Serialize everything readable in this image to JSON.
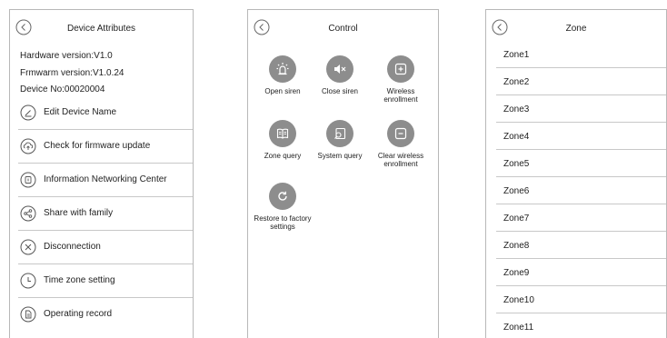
{
  "device_panel": {
    "title": "Device Attributes",
    "hardware_version": "Hardware version:V1.0",
    "firmware_version": "Frmwarm version:V1.0.24",
    "device_no": "Device No:00020004",
    "items": [
      {
        "label": "Edit Device Name",
        "icon": "edit-icon"
      },
      {
        "label": "Check for firmware update",
        "icon": "cloud-upload-icon"
      },
      {
        "label": "Information Networking Center",
        "icon": "info-center-icon"
      },
      {
        "label": "Share with family",
        "icon": "share-icon"
      },
      {
        "label": "Disconnection",
        "icon": "close-circle-icon"
      },
      {
        "label": "Time zone setting",
        "icon": "clock-icon"
      },
      {
        "label": "Operating record",
        "icon": "document-icon"
      }
    ]
  },
  "control_panel": {
    "title": "Control",
    "buttons": [
      {
        "label": "Open siren",
        "icon": "siren-icon"
      },
      {
        "label": "Close siren",
        "icon": "mute-icon"
      },
      {
        "label": "Wireless enrollment",
        "icon": "add-box-icon"
      },
      {
        "label": "Zone query",
        "icon": "book-icon"
      },
      {
        "label": "System query",
        "icon": "search-icon"
      },
      {
        "label": "Clear wireless enrollment",
        "icon": "minus-box-icon"
      },
      {
        "label": "Restore to factory settings",
        "icon": "restore-icon"
      }
    ]
  },
  "zone_panel": {
    "title": "Zone",
    "zones": [
      "Zone1",
      "Zone2",
      "Zone3",
      "Zone4",
      "Zone5",
      "Zone6",
      "Zone7",
      "Zone8",
      "Zone9",
      "Zone10",
      "Zone11"
    ]
  },
  "colors": {
    "icon_fill": "#8d8d8d",
    "border": "#b8b8b8",
    "divider": "#c8c8c8",
    "text": "#222222"
  }
}
